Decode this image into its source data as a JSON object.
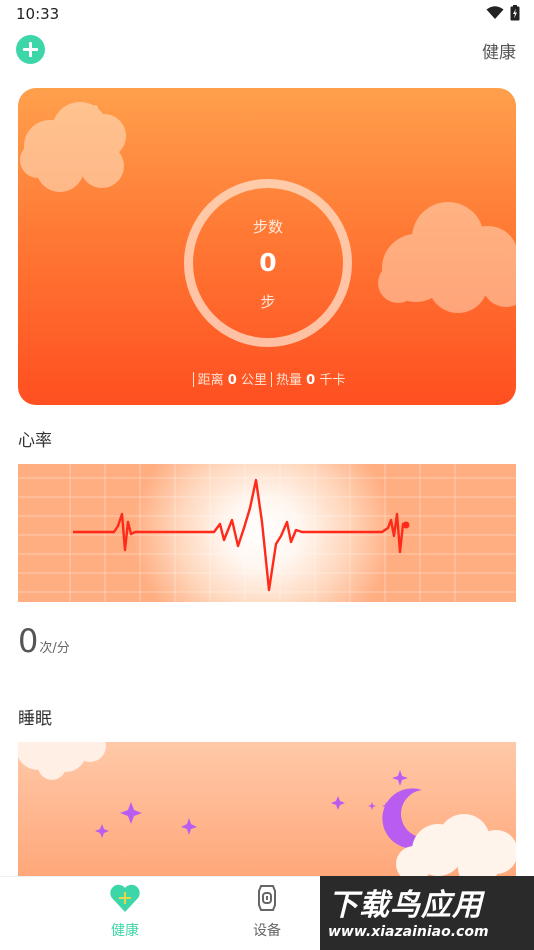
{
  "status_bar": {
    "time": "10:33",
    "icons": [
      "wifi-icon",
      "battery-icon"
    ]
  },
  "header": {
    "add_icon": "plus-circle-icon",
    "title": "健康"
  },
  "steps": {
    "label": "步数",
    "value": "0",
    "unit": "步",
    "distance_label": "距离",
    "distance_value": "0",
    "distance_unit": "公里",
    "calories_label": "热量",
    "calories_value": "0",
    "calories_unit": "千卡"
  },
  "heart_rate": {
    "title": "心率",
    "value": "0",
    "unit": "次/分"
  },
  "sleep": {
    "title": "睡眠"
  },
  "tabs": [
    {
      "label": "健康",
      "icon": "health-heart-icon",
      "active": true
    },
    {
      "label": "设备",
      "icon": "watch-icon",
      "active": false
    }
  ],
  "watermark": {
    "line1": "下载鸟应用",
    "line2": "www.xiazainiao.com"
  },
  "colors": {
    "accent": "#3dd6a8",
    "card_orange": "#ff6a2c",
    "heart_line": "#ff2a1a",
    "star_purple": "#b95cf0"
  }
}
